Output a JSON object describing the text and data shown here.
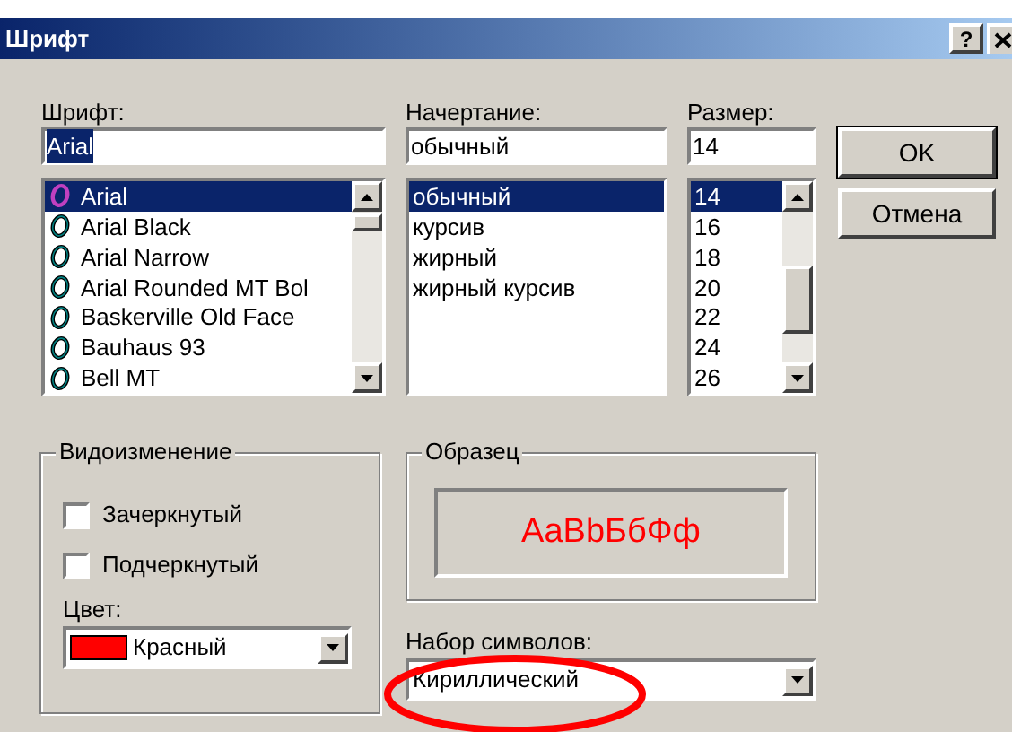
{
  "window": {
    "title": "Шрифт",
    "help_button": "?"
  },
  "font": {
    "label": "Шрифт:",
    "value": "Arial",
    "value_selected": true,
    "items": [
      {
        "name": "Arial",
        "kind": "opentype",
        "selected": true
      },
      {
        "name": "Arial Black",
        "kind": "truetype",
        "selected": false
      },
      {
        "name": "Arial Narrow",
        "kind": "truetype",
        "selected": false
      },
      {
        "name": "Arial Rounded MT Bol",
        "kind": "truetype",
        "selected": false
      },
      {
        "name": "Baskerville Old Face",
        "kind": "truetype",
        "selected": false
      },
      {
        "name": "Bauhaus 93",
        "kind": "truetype",
        "selected": false
      },
      {
        "name": "Bell MT",
        "kind": "truetype",
        "selected": false
      }
    ]
  },
  "style": {
    "label": "Начертание:",
    "value": "обычный",
    "items": [
      {
        "name": "обычный",
        "selected": true
      },
      {
        "name": "курсив",
        "selected": false
      },
      {
        "name": "жирный",
        "selected": false
      },
      {
        "name": "жирный курсив",
        "selected": false
      }
    ]
  },
  "size": {
    "label": "Размер:",
    "value": "14",
    "items": [
      {
        "name": "14",
        "selected": true
      },
      {
        "name": "16",
        "selected": false
      },
      {
        "name": "18",
        "selected": false
      },
      {
        "name": "20",
        "selected": false
      },
      {
        "name": "22",
        "selected": false
      },
      {
        "name": "24",
        "selected": false
      },
      {
        "name": "26",
        "selected": false
      }
    ]
  },
  "buttons": [
    {
      "label": "OK",
      "default": true
    },
    {
      "label": "Отмена",
      "default": false
    }
  ],
  "effects": {
    "title": "Видоизменение",
    "options": [
      {
        "label": "Зачеркнутый",
        "checked": false
      },
      {
        "label": "Подчеркнутый",
        "checked": false
      }
    ],
    "color_label": "Цвет:",
    "color": {
      "name": "Красный",
      "color": "#ff0000"
    }
  },
  "sample": {
    "title": "Образец",
    "text": "AaBbБбФф"
  },
  "charset": {
    "label": "Набор символов:",
    "value": "Кириллический",
    "highlighted": true
  }
}
